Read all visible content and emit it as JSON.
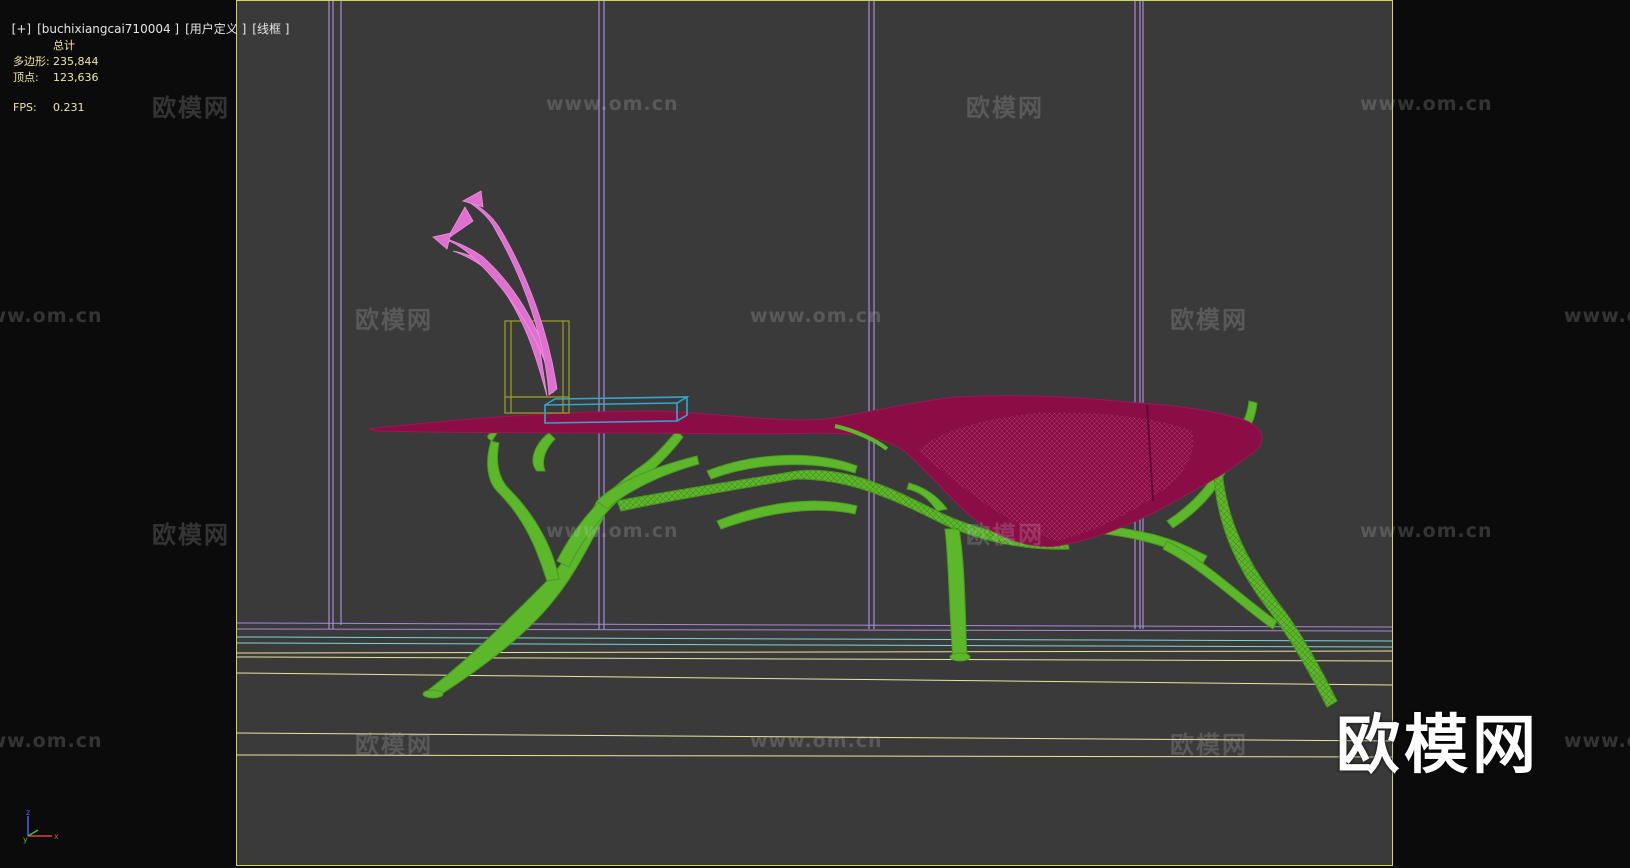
{
  "viewport_label": {
    "parts": [
      "[+]",
      "[buchixiangcai710004 ]",
      "[用户定义 ]",
      "[线框 ]"
    ]
  },
  "stats": {
    "header": "总计",
    "polygons_label": "多边形:",
    "polygons_value": "235,844",
    "vertices_label": "顶点:",
    "vertices_value": "123,636",
    "fps_label": "FPS:",
    "fps_value": "0.231"
  },
  "watermark": {
    "cn": "欧模网",
    "url": "www.om.cn",
    "logo": "欧模网"
  },
  "axis": {
    "z": "z",
    "y": "y",
    "x": "x"
  },
  "colors": {
    "viewport_bg": "#3a3a3a",
    "viewport_border": "#d4d45a",
    "table_top": "#8a0d45",
    "legs": "#5cb82a",
    "flowers": "#e070d0",
    "vase": "#a0a020",
    "tray": "#30a8d0",
    "panel_lines": "#a88ad8"
  }
}
